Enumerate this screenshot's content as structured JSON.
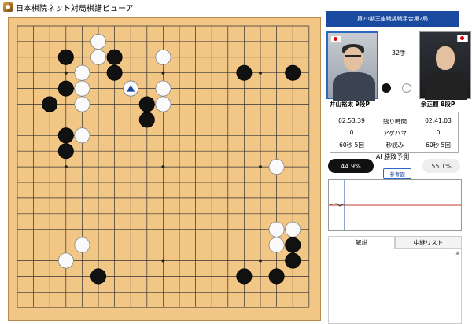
{
  "window": {
    "title": "日本棋院ネット対局棋譜ビューア"
  },
  "match": {
    "title": "第70期王座戦挑戦手合第2局",
    "move_count": "32手"
  },
  "players": {
    "black": {
      "name": "井山裕太 9段P"
    },
    "white": {
      "name": "余正麒 8段P"
    }
  },
  "stats": {
    "rows": [
      {
        "left": "02:53:39",
        "label": "残り時間",
        "right": "02:41:03"
      },
      {
        "left": "0",
        "label": "アゲハマ",
        "right": "0"
      },
      {
        "left": "60秒 5回",
        "label": "秒読み",
        "right": "60秒 5回"
      }
    ]
  },
  "ai": {
    "label": "AI 勝敗予測",
    "black_pct": "44.9%",
    "white_pct": "55.1%",
    "ref_button": "参考図",
    "black_rate": 0.449
  },
  "tabs": {
    "commentary": "解説",
    "relay": "中継リスト"
  },
  "colors": {
    "board": "#f2c685",
    "accent": "#1a4aa0",
    "graph_line": "#c0392b",
    "marker": "#1a4aa0"
  },
  "board": {
    "size": 19,
    "black_stones": [
      [
        3,
        2
      ],
      [
        6,
        2
      ],
      [
        6,
        3
      ],
      [
        3,
        4
      ],
      [
        2,
        5
      ],
      [
        8,
        5
      ],
      [
        8,
        6
      ],
      [
        3,
        7
      ],
      [
        3,
        8
      ],
      [
        14,
        3
      ],
      [
        17,
        3
      ],
      [
        17,
        14
      ],
      [
        17,
        15
      ],
      [
        5,
        16
      ],
      [
        14,
        16
      ],
      [
        16,
        16
      ]
    ],
    "white_stones": [
      [
        5,
        1
      ],
      [
        5,
        2
      ],
      [
        4,
        3
      ],
      [
        9,
        2
      ],
      [
        4,
        4
      ],
      [
        4,
        5
      ],
      [
        9,
        4
      ],
      [
        9,
        5
      ],
      [
        4,
        7
      ],
      [
        16,
        9
      ],
      [
        16,
        13
      ],
      [
        17,
        13
      ],
      [
        16,
        14
      ],
      [
        4,
        14
      ],
      [
        3,
        15
      ]
    ],
    "last_move": [
      7,
      4
    ],
    "hoshi": [
      [
        3,
        3
      ],
      [
        9,
        3
      ],
      [
        15,
        3
      ],
      [
        3,
        9
      ],
      [
        9,
        9
      ],
      [
        15,
        9
      ],
      [
        3,
        15
      ],
      [
        9,
        15
      ],
      [
        15,
        15
      ]
    ]
  }
}
